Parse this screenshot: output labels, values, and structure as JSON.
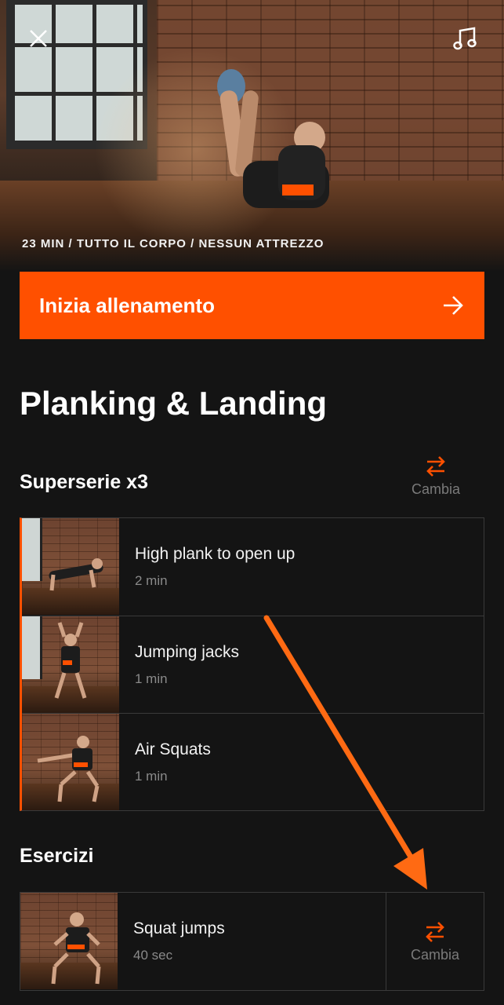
{
  "hero": {
    "caption": "23 MIN / TUTTO IL CORPO / NESSUN ATTREZZO",
    "close_icon": "close-icon",
    "music_icon": "music-note-icon"
  },
  "cta": {
    "label": "Inizia allenamento",
    "icon": "arrow-right-icon"
  },
  "workout": {
    "title": "Planking & Landing"
  },
  "superset": {
    "title": "Superserie x3",
    "swap_label": "Cambia",
    "items": [
      {
        "name": "High plank to open up",
        "duration": "2 min"
      },
      {
        "name": "Jumping jacks",
        "duration": "1 min"
      },
      {
        "name": "Air Squats",
        "duration": "1 min"
      }
    ]
  },
  "exercises": {
    "title": "Esercizi",
    "items": [
      {
        "name": "Squat jumps",
        "duration": "40 sec",
        "swap_label": "Cambia"
      }
    ]
  },
  "colors": {
    "accent": "#ff5000",
    "background": "#141414",
    "annotation_arrow": "#ff6a13",
    "muted_text": "#8a8a8a"
  }
}
